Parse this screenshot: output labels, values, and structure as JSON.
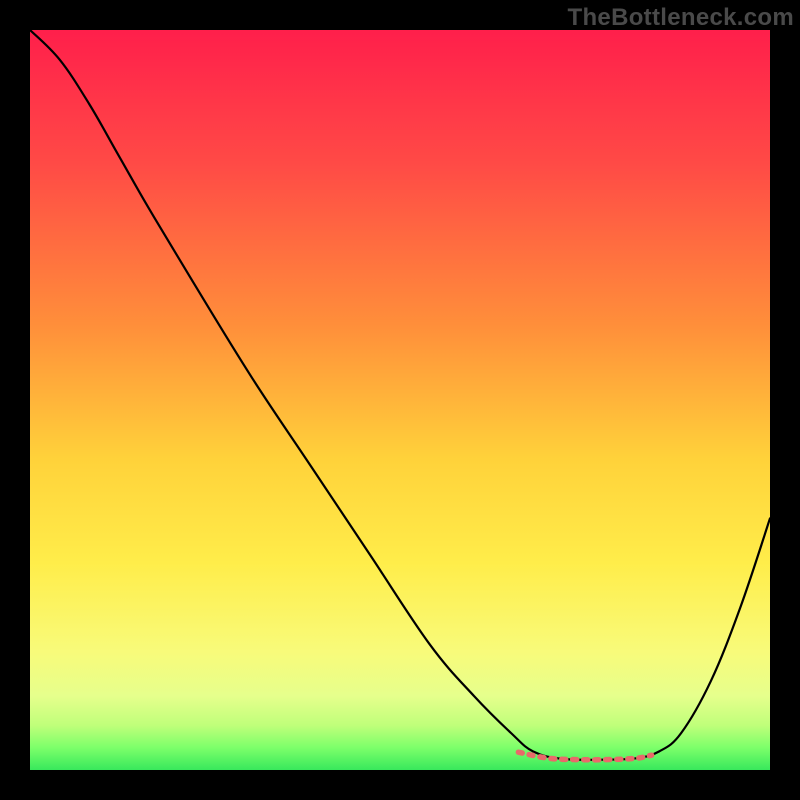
{
  "watermark": "TheBottleneck.com",
  "chart_data": {
    "type": "line",
    "title": "",
    "xlabel": "",
    "ylabel": "",
    "xlim": [
      0,
      100
    ],
    "ylim": [
      0,
      100
    ],
    "grid": false,
    "legend": null,
    "gradient_stops": [
      {
        "offset": 0,
        "color": "#ff1f4b"
      },
      {
        "offset": 18,
        "color": "#ff4a46"
      },
      {
        "offset": 40,
        "color": "#ff8f3a"
      },
      {
        "offset": 58,
        "color": "#ffd23a"
      },
      {
        "offset": 72,
        "color": "#ffed4a"
      },
      {
        "offset": 84,
        "color": "#f8fb7a"
      },
      {
        "offset": 90,
        "color": "#e6ff8c"
      },
      {
        "offset": 94,
        "color": "#bfff7a"
      },
      {
        "offset": 97,
        "color": "#7cff6a"
      },
      {
        "offset": 100,
        "color": "#38e85c"
      }
    ],
    "series": [
      {
        "name": "bottleneck-curve",
        "stroke": "#000000",
        "stroke_width": 2.2,
        "x": [
          0,
          4,
          8,
          12,
          16,
          22,
          30,
          38,
          46,
          54,
          60,
          65,
          68,
          72,
          78,
          82,
          85,
          88,
          92,
          96,
          100
        ],
        "y": [
          100,
          96,
          90,
          83,
          76,
          66,
          53,
          41,
          29,
          17,
          10,
          5,
          2.5,
          1.5,
          1.4,
          1.6,
          2.5,
          5,
          12,
          22,
          34
        ]
      },
      {
        "name": "flat-minimum-highlight",
        "stroke": "#e86a6a",
        "stroke_width": 5.5,
        "dash": "4 7",
        "x": [
          66,
          70,
          74,
          78,
          82,
          84
        ],
        "y": [
          2.4,
          1.6,
          1.4,
          1.4,
          1.6,
          2.0
        ]
      }
    ]
  }
}
